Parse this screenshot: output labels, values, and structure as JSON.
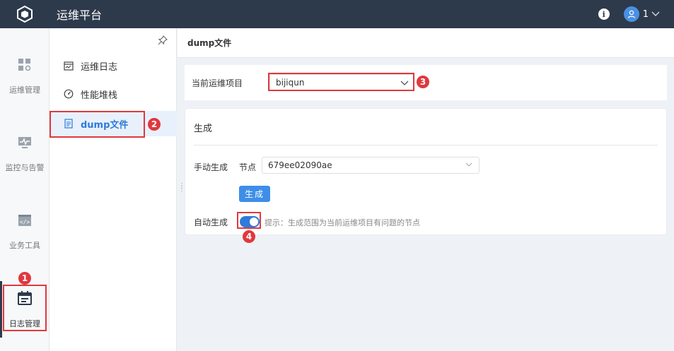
{
  "app": {
    "title": "运维平台",
    "info_label": "i",
    "user_name": "1"
  },
  "left_nav": [
    {
      "label": "运维管理",
      "icon": "grid-icon"
    },
    {
      "label": "监控与告警",
      "icon": "monitor-icon"
    },
    {
      "label": "业务工具",
      "icon": "code-window-icon"
    },
    {
      "label": "日志管理",
      "icon": "calendar-icon"
    }
  ],
  "sub_nav": [
    {
      "label": "运维日志",
      "icon": "log-icon"
    },
    {
      "label": "性能堆栈",
      "icon": "gauge-icon"
    },
    {
      "label": "dump文件",
      "icon": "document-icon"
    }
  ],
  "page": {
    "title": "dump文件",
    "project_label": "当前运维项目",
    "project_value": "bijiqun",
    "section_title": "生成",
    "manual_label": "手动生成",
    "node_label": "节点",
    "node_value": "679ee02090ae",
    "generate_button": "生成",
    "auto_label": "自动生成",
    "auto_enabled": true,
    "hint": "提示：生成范围为当前运维项目有问题的节点"
  },
  "badges": [
    "1",
    "2",
    "3",
    "4"
  ],
  "colors": {
    "topbar": "#2d3a4b",
    "accent": "#2e7bd9",
    "highlight": "#e0383e"
  }
}
